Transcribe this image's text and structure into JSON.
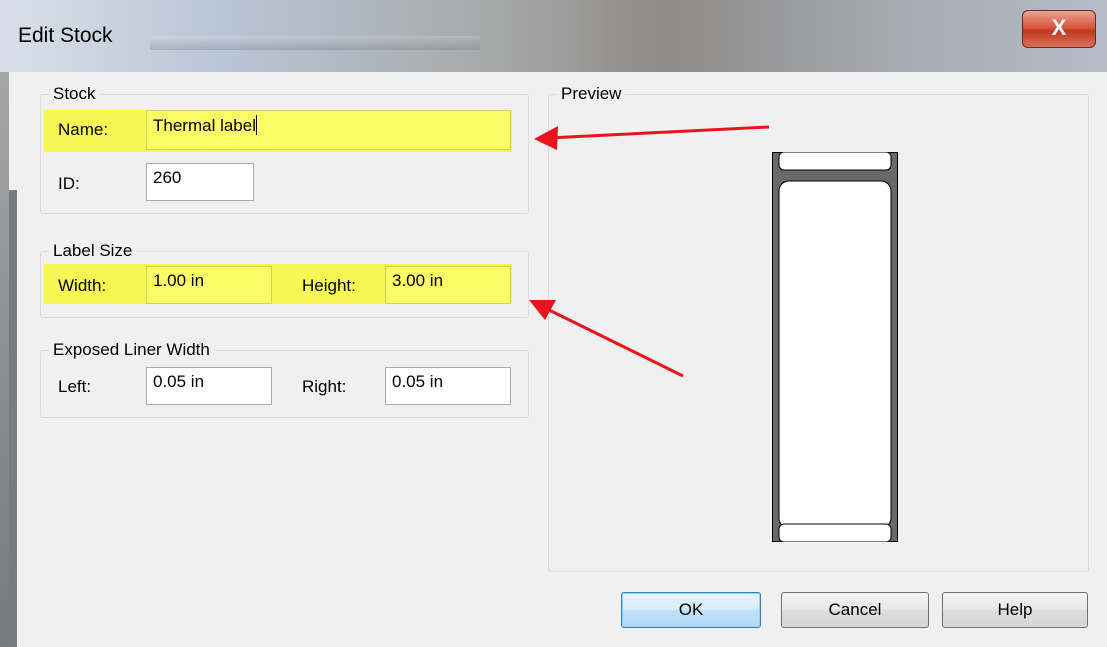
{
  "window": {
    "title": "Edit Stock",
    "close_glyph": "X"
  },
  "stock": {
    "group_title": "Stock",
    "name_label": "Name:",
    "name_value": "Thermal label",
    "id_label": "ID:",
    "id_value": "260"
  },
  "label_size": {
    "group_title": "Label Size",
    "width_label": "Width:",
    "width_value": "1.00 in",
    "height_label": "Height:",
    "height_value": "3.00 in"
  },
  "liner": {
    "group_title": "Exposed Liner Width",
    "left_label": "Left:",
    "left_value": "0.05 in",
    "right_label": "Right:",
    "right_value": "0.05 in"
  },
  "preview": {
    "group_title": "Preview"
  },
  "buttons": {
    "ok": "OK",
    "cancel": "Cancel",
    "help": "Help"
  },
  "colors": {
    "highlight": "#f7f73a",
    "annotation_arrow": "#e8141c",
    "liner_fill": "#696969"
  },
  "icons": {
    "close": "close-icon",
    "arrow": "red-annotation-arrow-icon"
  }
}
